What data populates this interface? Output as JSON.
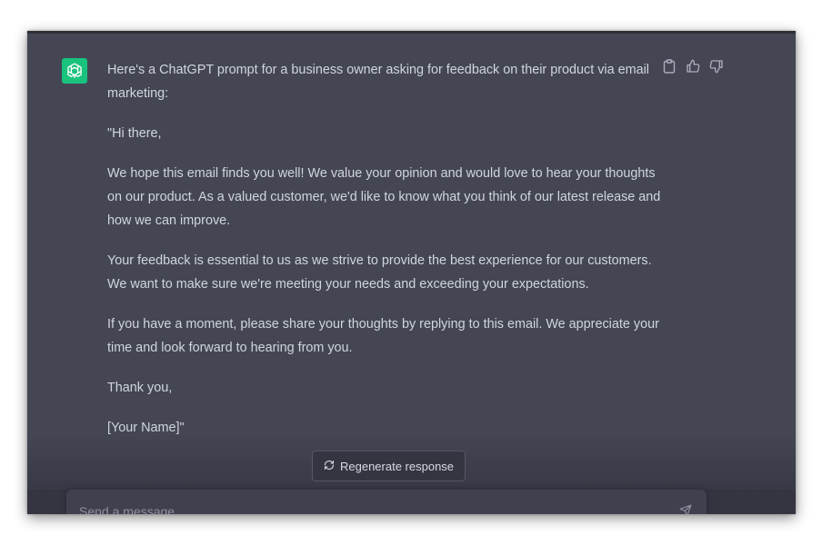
{
  "message": {
    "paragraphs": [
      "Here's a ChatGPT prompt for a business owner asking for feedback on their product via email marketing:",
      "\"Hi there,",
      "We hope this email finds you well! We value your opinion and would love to hear your thoughts on our product. As a valued customer, we'd like to know what you think of our latest release and how we can improve.",
      "Your feedback is essential to us as we strive to provide the best experience for our customers. We want to make sure we're meeting your needs and exceeding your expectations.",
      "If you have a moment, please share your thoughts by replying to this email. We appreciate your time and look forward to hearing from you.",
      "Thank you,",
      "[Your Name]\""
    ]
  },
  "actions": {
    "copy_icon": "clipboard-icon",
    "like_icon": "thumbs-up-icon",
    "dislike_icon": "thumbs-down-icon"
  },
  "regenerate": {
    "label": "Regenerate response",
    "icon": "refresh-icon"
  },
  "composer": {
    "placeholder": "Send a message...",
    "send_icon": "send-icon"
  },
  "colors": {
    "panel": "#444654",
    "avatar": "#19c37d",
    "text": "#d1d5db",
    "input": "#40414f"
  }
}
